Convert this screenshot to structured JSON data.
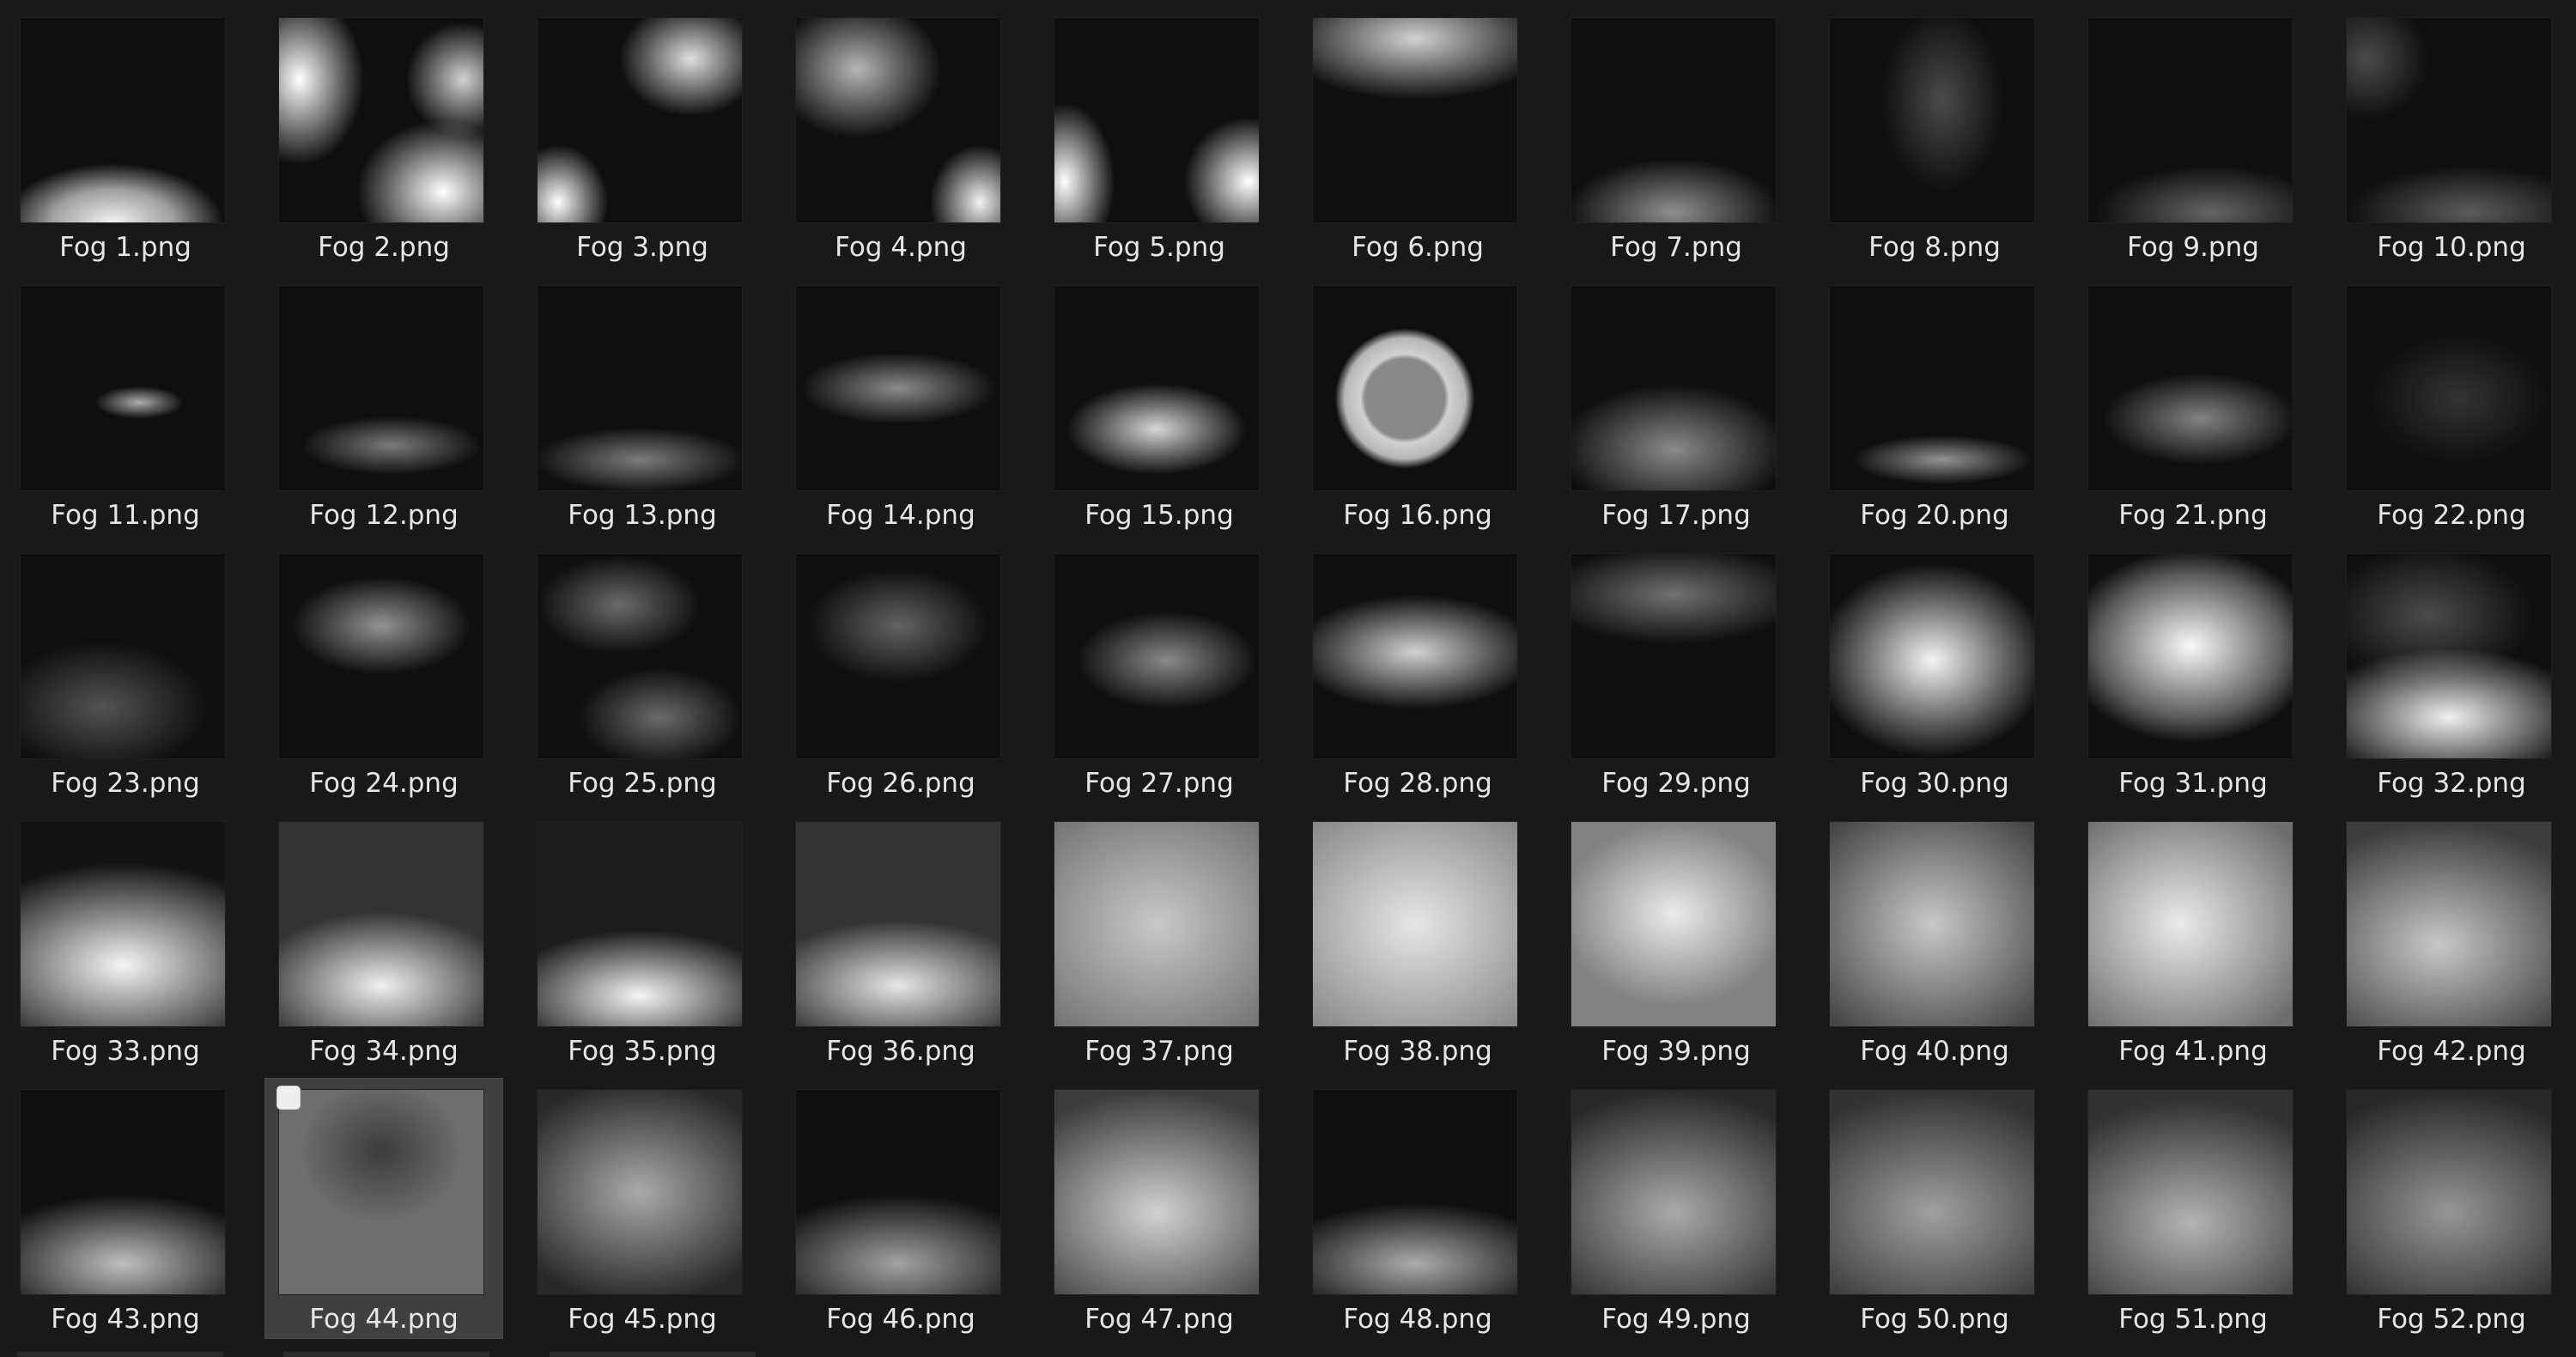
{
  "files": [
    {
      "name": "Fog 1.png",
      "icon": "fog-thumbnail-icon"
    },
    {
      "name": "Fog 2.png",
      "icon": "fog-thumbnail-icon"
    },
    {
      "name": "Fog 3.png",
      "icon": "fog-thumbnail-icon"
    },
    {
      "name": "Fog 4.png",
      "icon": "fog-thumbnail-icon"
    },
    {
      "name": "Fog 5.png",
      "icon": "fog-thumbnail-icon"
    },
    {
      "name": "Fog 6.png",
      "icon": "fog-thumbnail-icon"
    },
    {
      "name": "Fog 7.png",
      "icon": "fog-thumbnail-icon"
    },
    {
      "name": "Fog 8.png",
      "icon": "fog-thumbnail-icon"
    },
    {
      "name": "Fog 9.png",
      "icon": "fog-thumbnail-icon"
    },
    {
      "name": "Fog 10.png",
      "icon": "fog-thumbnail-icon"
    },
    {
      "name": "Fog 11.png",
      "icon": "fog-thumbnail-icon"
    },
    {
      "name": "Fog 12.png",
      "icon": "fog-thumbnail-icon"
    },
    {
      "name": "Fog 13.png",
      "icon": "fog-thumbnail-icon"
    },
    {
      "name": "Fog 14.png",
      "icon": "fog-thumbnail-icon"
    },
    {
      "name": "Fog 15.png",
      "icon": "fog-thumbnail-icon"
    },
    {
      "name": "Fog 16.png",
      "icon": "fog-thumbnail-icon"
    },
    {
      "name": "Fog 17.png",
      "icon": "fog-thumbnail-icon"
    },
    {
      "name": "Fog 20.png",
      "icon": "fog-thumbnail-icon"
    },
    {
      "name": "Fog 21.png",
      "icon": "fog-thumbnail-icon"
    },
    {
      "name": "Fog 22.png",
      "icon": "fog-thumbnail-icon"
    },
    {
      "name": "Fog 23.png",
      "icon": "fog-thumbnail-icon"
    },
    {
      "name": "Fog 24.png",
      "icon": "fog-thumbnail-icon"
    },
    {
      "name": "Fog 25.png",
      "icon": "fog-thumbnail-icon"
    },
    {
      "name": "Fog 26.png",
      "icon": "fog-thumbnail-icon"
    },
    {
      "name": "Fog 27.png",
      "icon": "fog-thumbnail-icon"
    },
    {
      "name": "Fog 28.png",
      "icon": "fog-thumbnail-icon"
    },
    {
      "name": "Fog 29.png",
      "icon": "fog-thumbnail-icon"
    },
    {
      "name": "Fog 30.png",
      "icon": "fog-thumbnail-icon"
    },
    {
      "name": "Fog 31.png",
      "icon": "fog-thumbnail-icon"
    },
    {
      "name": "Fog 32.png",
      "icon": "fog-thumbnail-icon"
    },
    {
      "name": "Fog 33.png",
      "icon": "fog-thumbnail-icon"
    },
    {
      "name": "Fog 34.png",
      "icon": "fog-thumbnail-icon"
    },
    {
      "name": "Fog 35.png",
      "icon": "fog-thumbnail-icon"
    },
    {
      "name": "Fog 36.png",
      "icon": "fog-thumbnail-icon"
    },
    {
      "name": "Fog 37.png",
      "icon": "fog-thumbnail-icon"
    },
    {
      "name": "Fog 38.png",
      "icon": "fog-thumbnail-icon"
    },
    {
      "name": "Fog 39.png",
      "icon": "fog-thumbnail-icon"
    },
    {
      "name": "Fog 40.png",
      "icon": "fog-thumbnail-icon"
    },
    {
      "name": "Fog 41.png",
      "icon": "fog-thumbnail-icon"
    },
    {
      "name": "Fog 42.png",
      "icon": "fog-thumbnail-icon"
    },
    {
      "name": "Fog 43.png",
      "icon": "fog-thumbnail-icon"
    },
    {
      "name": "Fog 44.png",
      "icon": "fog-thumbnail-icon",
      "selected": true
    },
    {
      "name": "Fog 45.png",
      "icon": "fog-thumbnail-icon"
    },
    {
      "name": "Fog 46.png",
      "icon": "fog-thumbnail-icon"
    },
    {
      "name": "Fog 47.png",
      "icon": "fog-thumbnail-icon"
    },
    {
      "name": "Fog 48.png",
      "icon": "fog-thumbnail-icon"
    },
    {
      "name": "Fog 49.png",
      "icon": "fog-thumbnail-icon"
    },
    {
      "name": "Fog 50.png",
      "icon": "fog-thumbnail-icon"
    },
    {
      "name": "Fog 51.png",
      "icon": "fog-thumbnail-icon"
    },
    {
      "name": "Fog 52.png",
      "icon": "fog-thumbnail-icon"
    }
  ],
  "colors": {
    "background": "#191919",
    "selection": "#404040",
    "label": "#e6e6e6",
    "thumb_background": "#0f0f0f"
  }
}
